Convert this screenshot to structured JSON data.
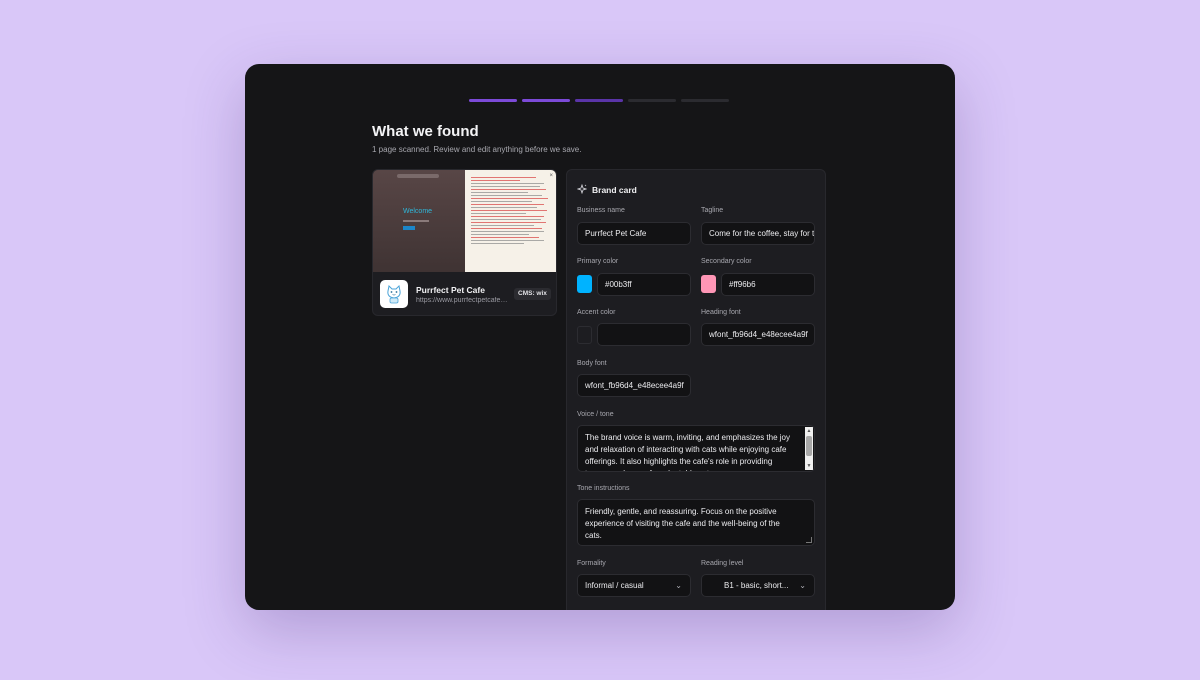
{
  "page": {
    "title": "What we found",
    "subtitle": "1 page scanned. Review and edit anything before we save."
  },
  "progress": {
    "total_steps": 5,
    "completed_steps": 3
  },
  "preview": {
    "screenshot_welcome": "Welcome",
    "site_name": "Purrfect Pet Cafe",
    "site_url": "https://www.purrfectpetcafe.com",
    "cms_badge": "CMS: wix"
  },
  "brand_card": {
    "heading": "Brand card",
    "business_name": {
      "label": "Business name",
      "value": "Purrfect Pet Cafe"
    },
    "tagline": {
      "label": "Tagline",
      "value": "Come for the coffee, stay for the cats"
    },
    "primary_color": {
      "label": "Primary color",
      "value": "#00b3ff",
      "swatch": "#00b3ff"
    },
    "secondary_color": {
      "label": "Secondary color",
      "value": "#ff96b6",
      "swatch": "#ff96b6"
    },
    "accent_color": {
      "label": "Accent color",
      "value": "",
      "swatch": "#1d1d21"
    },
    "heading_font": {
      "label": "Heading font",
      "value": "wfont_fb96d4_e48ecee4a9f"
    },
    "body_font": {
      "label": "Body font",
      "value": "wfont_fb96d4_e48ecee4a9f"
    },
    "voice_tone": {
      "label": "Voice / tone",
      "value": "The brand voice is warm, inviting, and emphasizes the joy and relaxation of interacting with cats while enjoying cafe offerings. It also highlights the cafe's role in providing temporary homes for adoptable cats."
    },
    "tone_instructions": {
      "label": "Tone instructions",
      "value": "Friendly, gentle, and reassuring. Focus on the positive experience of visiting the cafe and the well-being of the cats."
    },
    "formality": {
      "label": "Formality",
      "value": "Informal / casual"
    },
    "reading_level": {
      "label": "Reading level",
      "value": "B1 - basic, short..."
    }
  },
  "colors": {
    "accent": "#7c4ad8",
    "background": "#151517",
    "page_bg": "#d9c7f8"
  },
  "icons": {
    "brand_card": "sparkle-icon",
    "dropdown": "chevron-down-icon"
  }
}
